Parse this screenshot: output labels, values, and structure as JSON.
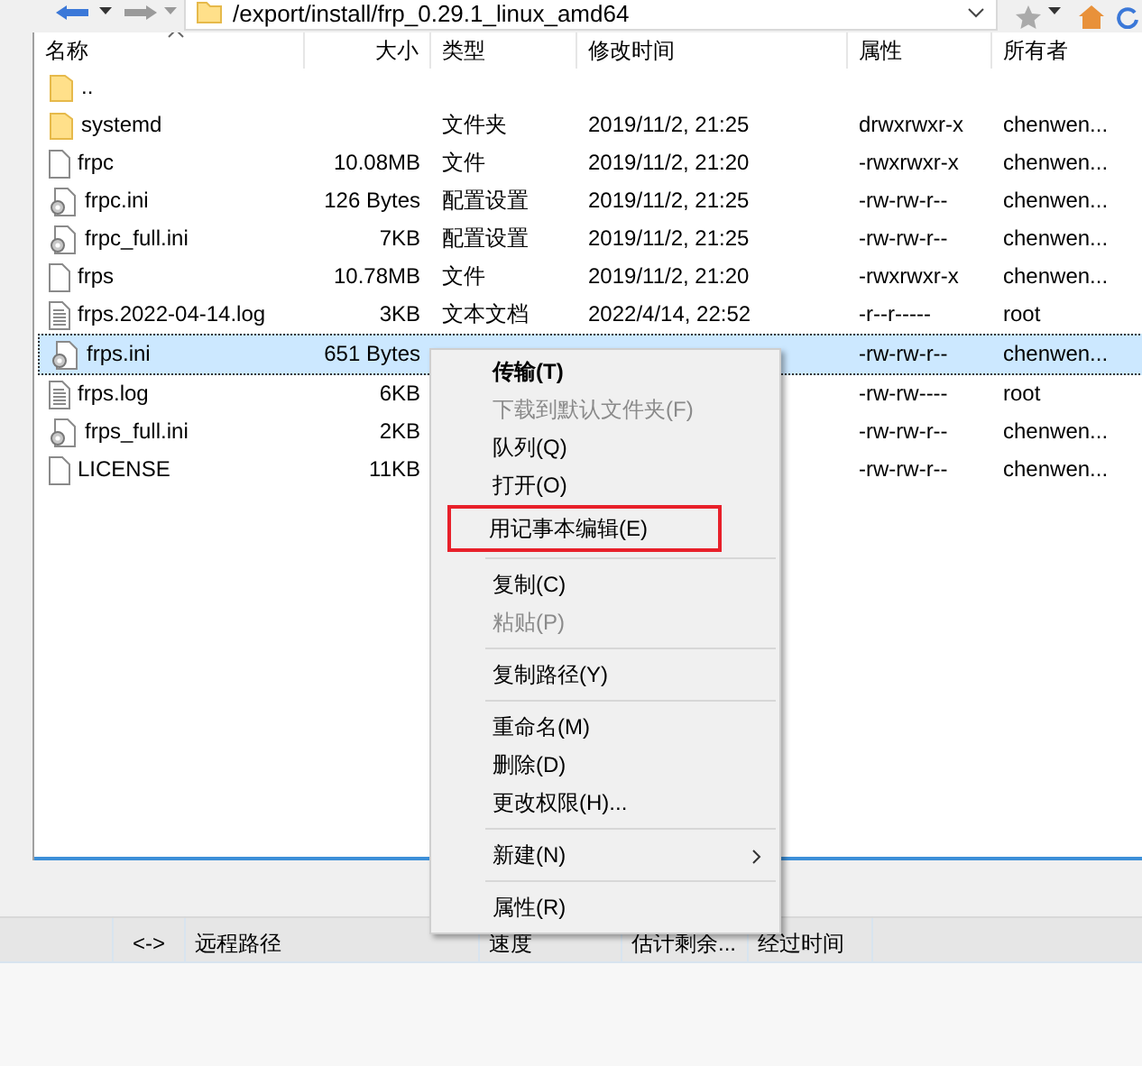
{
  "toolbar": {
    "path": "/export/install/frp_0.29.1_linux_amd64"
  },
  "file_list": {
    "columns": [
      "名称",
      "大小",
      "类型",
      "修改时间",
      "属性",
      "所有者"
    ],
    "files": [
      {
        "name": "..",
        "kind": "folder",
        "selected": false
      },
      {
        "name": "systemd",
        "kind": "folder",
        "type": "文件夹",
        "modified": "2019/11/2, 21:25",
        "attributes": "drwxrwxr-x",
        "owner": "chenwen...",
        "selected": false
      },
      {
        "name": "frpc",
        "kind": "file",
        "size": "10.08MB",
        "type": "文件",
        "modified": "2019/11/2, 21:20",
        "attributes": "-rwxrwxr-x",
        "owner": "chenwen...",
        "selected": false
      },
      {
        "name": "frpc.ini",
        "kind": "config",
        "size": "126 Bytes",
        "type": "配置设置",
        "modified": "2019/11/2, 21:25",
        "attributes": "-rw-rw-r--",
        "owner": "chenwen...",
        "selected": false
      },
      {
        "name": "frpc_full.ini",
        "kind": "config",
        "size": "7KB",
        "type": "配置设置",
        "modified": "2019/11/2, 21:25",
        "attributes": "-rw-rw-r--",
        "owner": "chenwen...",
        "selected": false
      },
      {
        "name": "frps",
        "kind": "file",
        "size": "10.78MB",
        "type": "文件",
        "modified": "2019/11/2, 21:20",
        "attributes": "-rwxrwxr-x",
        "owner": "chenwen...",
        "selected": false
      },
      {
        "name": "frps.2022-04-14.log",
        "kind": "text",
        "size": "3KB",
        "type": "文本文档",
        "modified": "2022/4/14, 22:52",
        "attributes": "-r--r-----",
        "owner": "root",
        "selected": false
      },
      {
        "name": "frps.ini",
        "kind": "config",
        "size": "651 Bytes",
        "attributes": "-rw-rw-r--",
        "owner": "chenwen...",
        "selected": true
      },
      {
        "name": "frps.log",
        "kind": "text",
        "size": "6KB",
        "attributes": "-rw-rw----",
        "owner": "root",
        "selected": false
      },
      {
        "name": "frps_full.ini",
        "kind": "config",
        "size": "2KB",
        "attributes": "-rw-rw-r--",
        "owner": "chenwen...",
        "selected": false
      },
      {
        "name": "LICENSE",
        "kind": "file",
        "size": "11KB",
        "attributes": "-rw-rw-r--",
        "owner": "chenwen...",
        "selected": false
      }
    ]
  },
  "context_menu": [
    {
      "kind": "item",
      "label": "传输(T)",
      "bold": true,
      "disabled": false,
      "outlined": false
    },
    {
      "kind": "item",
      "label": "下载到默认文件夹(F)",
      "bold": false,
      "disabled": true,
      "outlined": false
    },
    {
      "kind": "item",
      "label": "队列(Q)",
      "bold": false,
      "disabled": false,
      "outlined": false
    },
    {
      "kind": "item",
      "label": "打开(O)",
      "bold": false,
      "disabled": false,
      "outlined": false
    },
    {
      "kind": "item",
      "label": "用记事本编辑(E)",
      "bold": false,
      "disabled": false,
      "outlined": true
    },
    {
      "kind": "separator"
    },
    {
      "kind": "item",
      "label": "复制(C)",
      "bold": false,
      "disabled": false,
      "outlined": false
    },
    {
      "kind": "item",
      "label": "粘贴(P)",
      "bold": false,
      "disabled": true,
      "outlined": false
    },
    {
      "kind": "separator"
    },
    {
      "kind": "item",
      "label": "复制路径(Y)",
      "bold": false,
      "disabled": false,
      "outlined": false
    },
    {
      "kind": "separator"
    },
    {
      "kind": "item",
      "label": "重命名(M)",
      "bold": false,
      "disabled": false,
      "outlined": false
    },
    {
      "kind": "item",
      "label": "删除(D)",
      "bold": false,
      "disabled": false,
      "outlined": false
    },
    {
      "kind": "item",
      "label": "更改权限(H)...",
      "bold": false,
      "disabled": false,
      "outlined": false
    },
    {
      "kind": "separator"
    },
    {
      "kind": "submenu",
      "label": "新建(N)",
      "bold": false,
      "disabled": false,
      "outlined": false
    },
    {
      "kind": "separator"
    },
    {
      "kind": "item",
      "label": "属性(R)",
      "bold": false,
      "disabled": false,
      "outlined": false
    }
  ],
  "transfer_queue": {
    "columns": [
      "<->",
      "远程路径",
      "速度",
      "估计剩余...",
      "经过时间"
    ]
  }
}
